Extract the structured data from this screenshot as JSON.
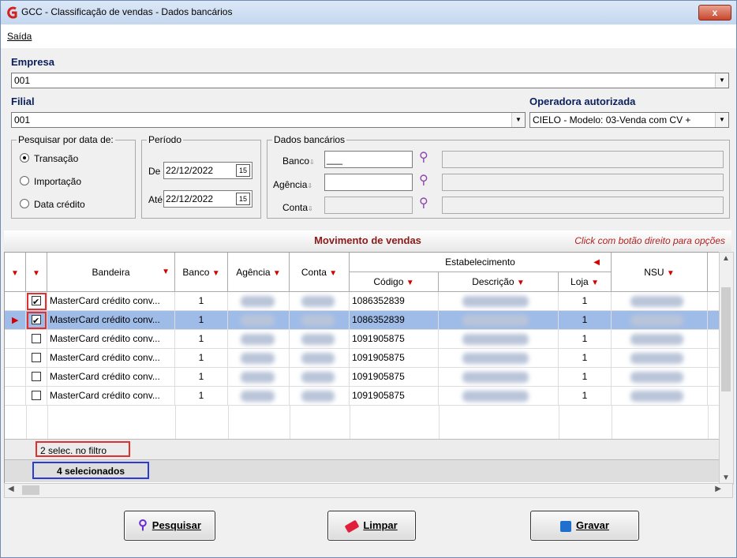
{
  "window": {
    "title": "GCC - Classificação de vendas - Dados bancários",
    "close_label": "x"
  },
  "menu": {
    "saida": "Saída"
  },
  "empresa": {
    "label": "Empresa",
    "value": "001"
  },
  "filial": {
    "label": "Filial",
    "value": "001"
  },
  "operadora": {
    "label": "Operadora autorizada",
    "value": "CIELO - Modelo: 03-Venda com CV +"
  },
  "pesquisar": {
    "caption": "Pesquisar por data de:",
    "options": [
      "Transação",
      "Importação",
      "Data crédito"
    ],
    "selected": "Transação"
  },
  "periodo": {
    "caption": "Período",
    "de_label": "De",
    "de_value": "22/12/2022",
    "ate_label": "Até",
    "ate_value": "22/12/2022",
    "cal_icon": "15"
  },
  "dados_bancarios": {
    "caption": "Dados bancários",
    "banco_label": "Banco",
    "agencia_label": "Agência",
    "conta_label": "Conta",
    "banco_value": "___",
    "agencia_value": "",
    "conta_value": ""
  },
  "grid": {
    "title": "Movimento de vendas",
    "hint": "Click com botão direito para opções",
    "group_header": "Estabelecimento",
    "columns": {
      "bandeira": "Bandeira",
      "banco": "Banco",
      "agencia": "Agência",
      "conta": "Conta",
      "codigo": "Código",
      "descricao": "Descrição",
      "loja": "Loja",
      "nsu": "NSU"
    },
    "rows": [
      {
        "checked": true,
        "bandeira": "MasterCard crédito conv...",
        "banco": "1",
        "codigo": "1086352839",
        "loja": "1",
        "current": false
      },
      {
        "checked": true,
        "bandeira": "MasterCard crédito conv...",
        "banco": "1",
        "codigo": "1086352839",
        "loja": "1",
        "current": true
      },
      {
        "checked": false,
        "bandeira": "MasterCard crédito conv...",
        "banco": "1",
        "codigo": "1091905875",
        "loja": "1",
        "current": false
      },
      {
        "checked": false,
        "bandeira": "MasterCard crédito conv...",
        "banco": "1",
        "codigo": "1091905875",
        "loja": "1",
        "current": false
      },
      {
        "checked": false,
        "bandeira": "MasterCard crédito conv...",
        "banco": "1",
        "codigo": "1091905875",
        "loja": "1",
        "current": false
      },
      {
        "checked": false,
        "bandeira": "MasterCard crédito conv...",
        "banco": "1",
        "codigo": "1091905875",
        "loja": "1",
        "current": false
      }
    ],
    "footer_filter": "2 selec. no filtro",
    "footer_total": "4 selecionados"
  },
  "buttons": {
    "pesquisar": "Pesquisar",
    "limpar": "Limpar",
    "gravar": "Gravar"
  },
  "colors": {
    "accent_red": "#d40000",
    "selection": "#9fbce8",
    "label_blue": "#0a1f5c"
  }
}
